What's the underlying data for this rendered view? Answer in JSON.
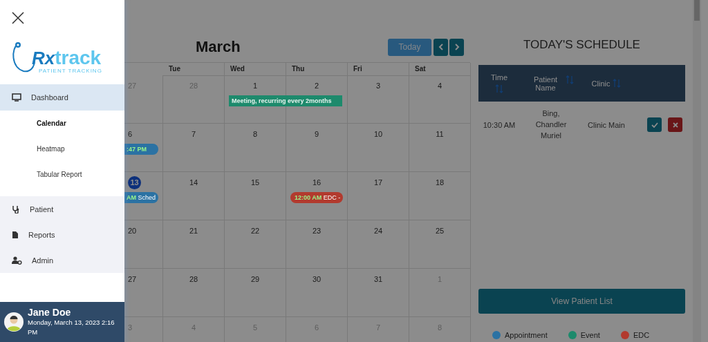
{
  "sidebar": {
    "logo": {
      "mark": "Rx",
      "wordmark": "track",
      "tagline": "PATIENT TRACKING"
    },
    "nav": [
      {
        "label": "Dashboard",
        "selected": true,
        "expanded": true,
        "children": [
          {
            "label": "Calendar",
            "selected": true
          },
          {
            "label": "Heatmap",
            "selected": false
          },
          {
            "label": "Tabular Report",
            "selected": false
          }
        ]
      },
      {
        "label": "Patient",
        "selected": false
      },
      {
        "label": "Reports",
        "selected": false
      },
      {
        "label": "Admin",
        "selected": false
      }
    ],
    "user": {
      "name": "Jane Doe",
      "datetime": "Monday, March 13, 2023 2:16 PM"
    }
  },
  "calendar": {
    "title": "March",
    "today_button": "Today",
    "weekdays": [
      "Tue",
      "Wed",
      "Thu",
      "Fri",
      "Sat"
    ],
    "weeks": [
      {
        "days": [
          {
            "day": "27",
            "muted": true,
            "today": false
          },
          {
            "day": "28",
            "muted": true,
            "today": false
          },
          {
            "day": "1",
            "muted": false,
            "today": false,
            "events": [
              {
                "kind": "allday",
                "title": "Meeting, recurring every 2months",
                "color": "#1d8a6c"
              }
            ]
          },
          {
            "day": "2",
            "muted": false,
            "today": false
          },
          {
            "day": "3",
            "muted": false,
            "today": false
          },
          {
            "day": "4",
            "muted": false,
            "today": false
          }
        ]
      },
      {
        "days": [
          {
            "day": "6",
            "muted": false,
            "today": false,
            "events": [
              {
                "kind": "timed",
                "time": ":47 PM",
                "color": "#2b72a3"
              }
            ]
          },
          {
            "day": "7",
            "muted": false,
            "today": false
          },
          {
            "day": "8",
            "muted": false,
            "today": false
          },
          {
            "day": "9",
            "muted": false,
            "today": false
          },
          {
            "day": "10",
            "muted": false,
            "today": false
          },
          {
            "day": "11",
            "muted": false,
            "today": false
          }
        ]
      },
      {
        "days": [
          {
            "day": "13",
            "muted": false,
            "today": true,
            "events": [
              {
                "kind": "timed",
                "time": "AM",
                "title": "Sched",
                "color": "#2b72a3"
              }
            ]
          },
          {
            "day": "14",
            "muted": false,
            "today": false
          },
          {
            "day": "15",
            "muted": false,
            "today": false
          },
          {
            "day": "16",
            "muted": false,
            "today": false,
            "events": [
              {
                "kind": "timed",
                "time": "12:00 AM",
                "title": "EDC -",
                "color": "#b23a2e"
              }
            ]
          },
          {
            "day": "17",
            "muted": false,
            "today": false
          },
          {
            "day": "18",
            "muted": false,
            "today": false
          }
        ]
      },
      {
        "days": [
          {
            "day": "20",
            "muted": false,
            "today": false
          },
          {
            "day": "21",
            "muted": false,
            "today": false
          },
          {
            "day": "22",
            "muted": false,
            "today": false
          },
          {
            "day": "23",
            "muted": false,
            "today": false
          },
          {
            "day": "24",
            "muted": false,
            "today": false
          },
          {
            "day": "25",
            "muted": false,
            "today": false
          }
        ]
      },
      {
        "days": [
          {
            "day": "27",
            "muted": false,
            "today": false
          },
          {
            "day": "28",
            "muted": false,
            "today": false
          },
          {
            "day": "29",
            "muted": false,
            "today": false
          },
          {
            "day": "30",
            "muted": false,
            "today": false
          },
          {
            "day": "31",
            "muted": false,
            "today": false
          },
          {
            "day": "1",
            "muted": true,
            "today": false
          }
        ]
      },
      {
        "days": [
          {
            "day": "3",
            "muted": true,
            "today": false
          },
          {
            "day": "4",
            "muted": true,
            "today": false
          },
          {
            "day": "5",
            "muted": true,
            "today": false
          },
          {
            "day": "6",
            "muted": true,
            "today": false
          },
          {
            "day": "7",
            "muted": true,
            "today": false
          },
          {
            "day": "8",
            "muted": true,
            "today": false
          }
        ]
      }
    ]
  },
  "schedule": {
    "title": "TODAY'S SCHEDULE",
    "columns": [
      "Time",
      "Patient Name",
      "Clinic"
    ],
    "rows": [
      {
        "time": "10:30 AM",
        "patient": "Bing, Chandler Muriel",
        "clinic": "Clinic Main"
      }
    ],
    "view_button": "View Patient List",
    "legend": [
      {
        "label": "Appointment",
        "color": "#2b72a3"
      },
      {
        "label": "Event",
        "color": "#1d8a6c"
      },
      {
        "label": "EDC",
        "color": "#b23a2e"
      }
    ]
  }
}
